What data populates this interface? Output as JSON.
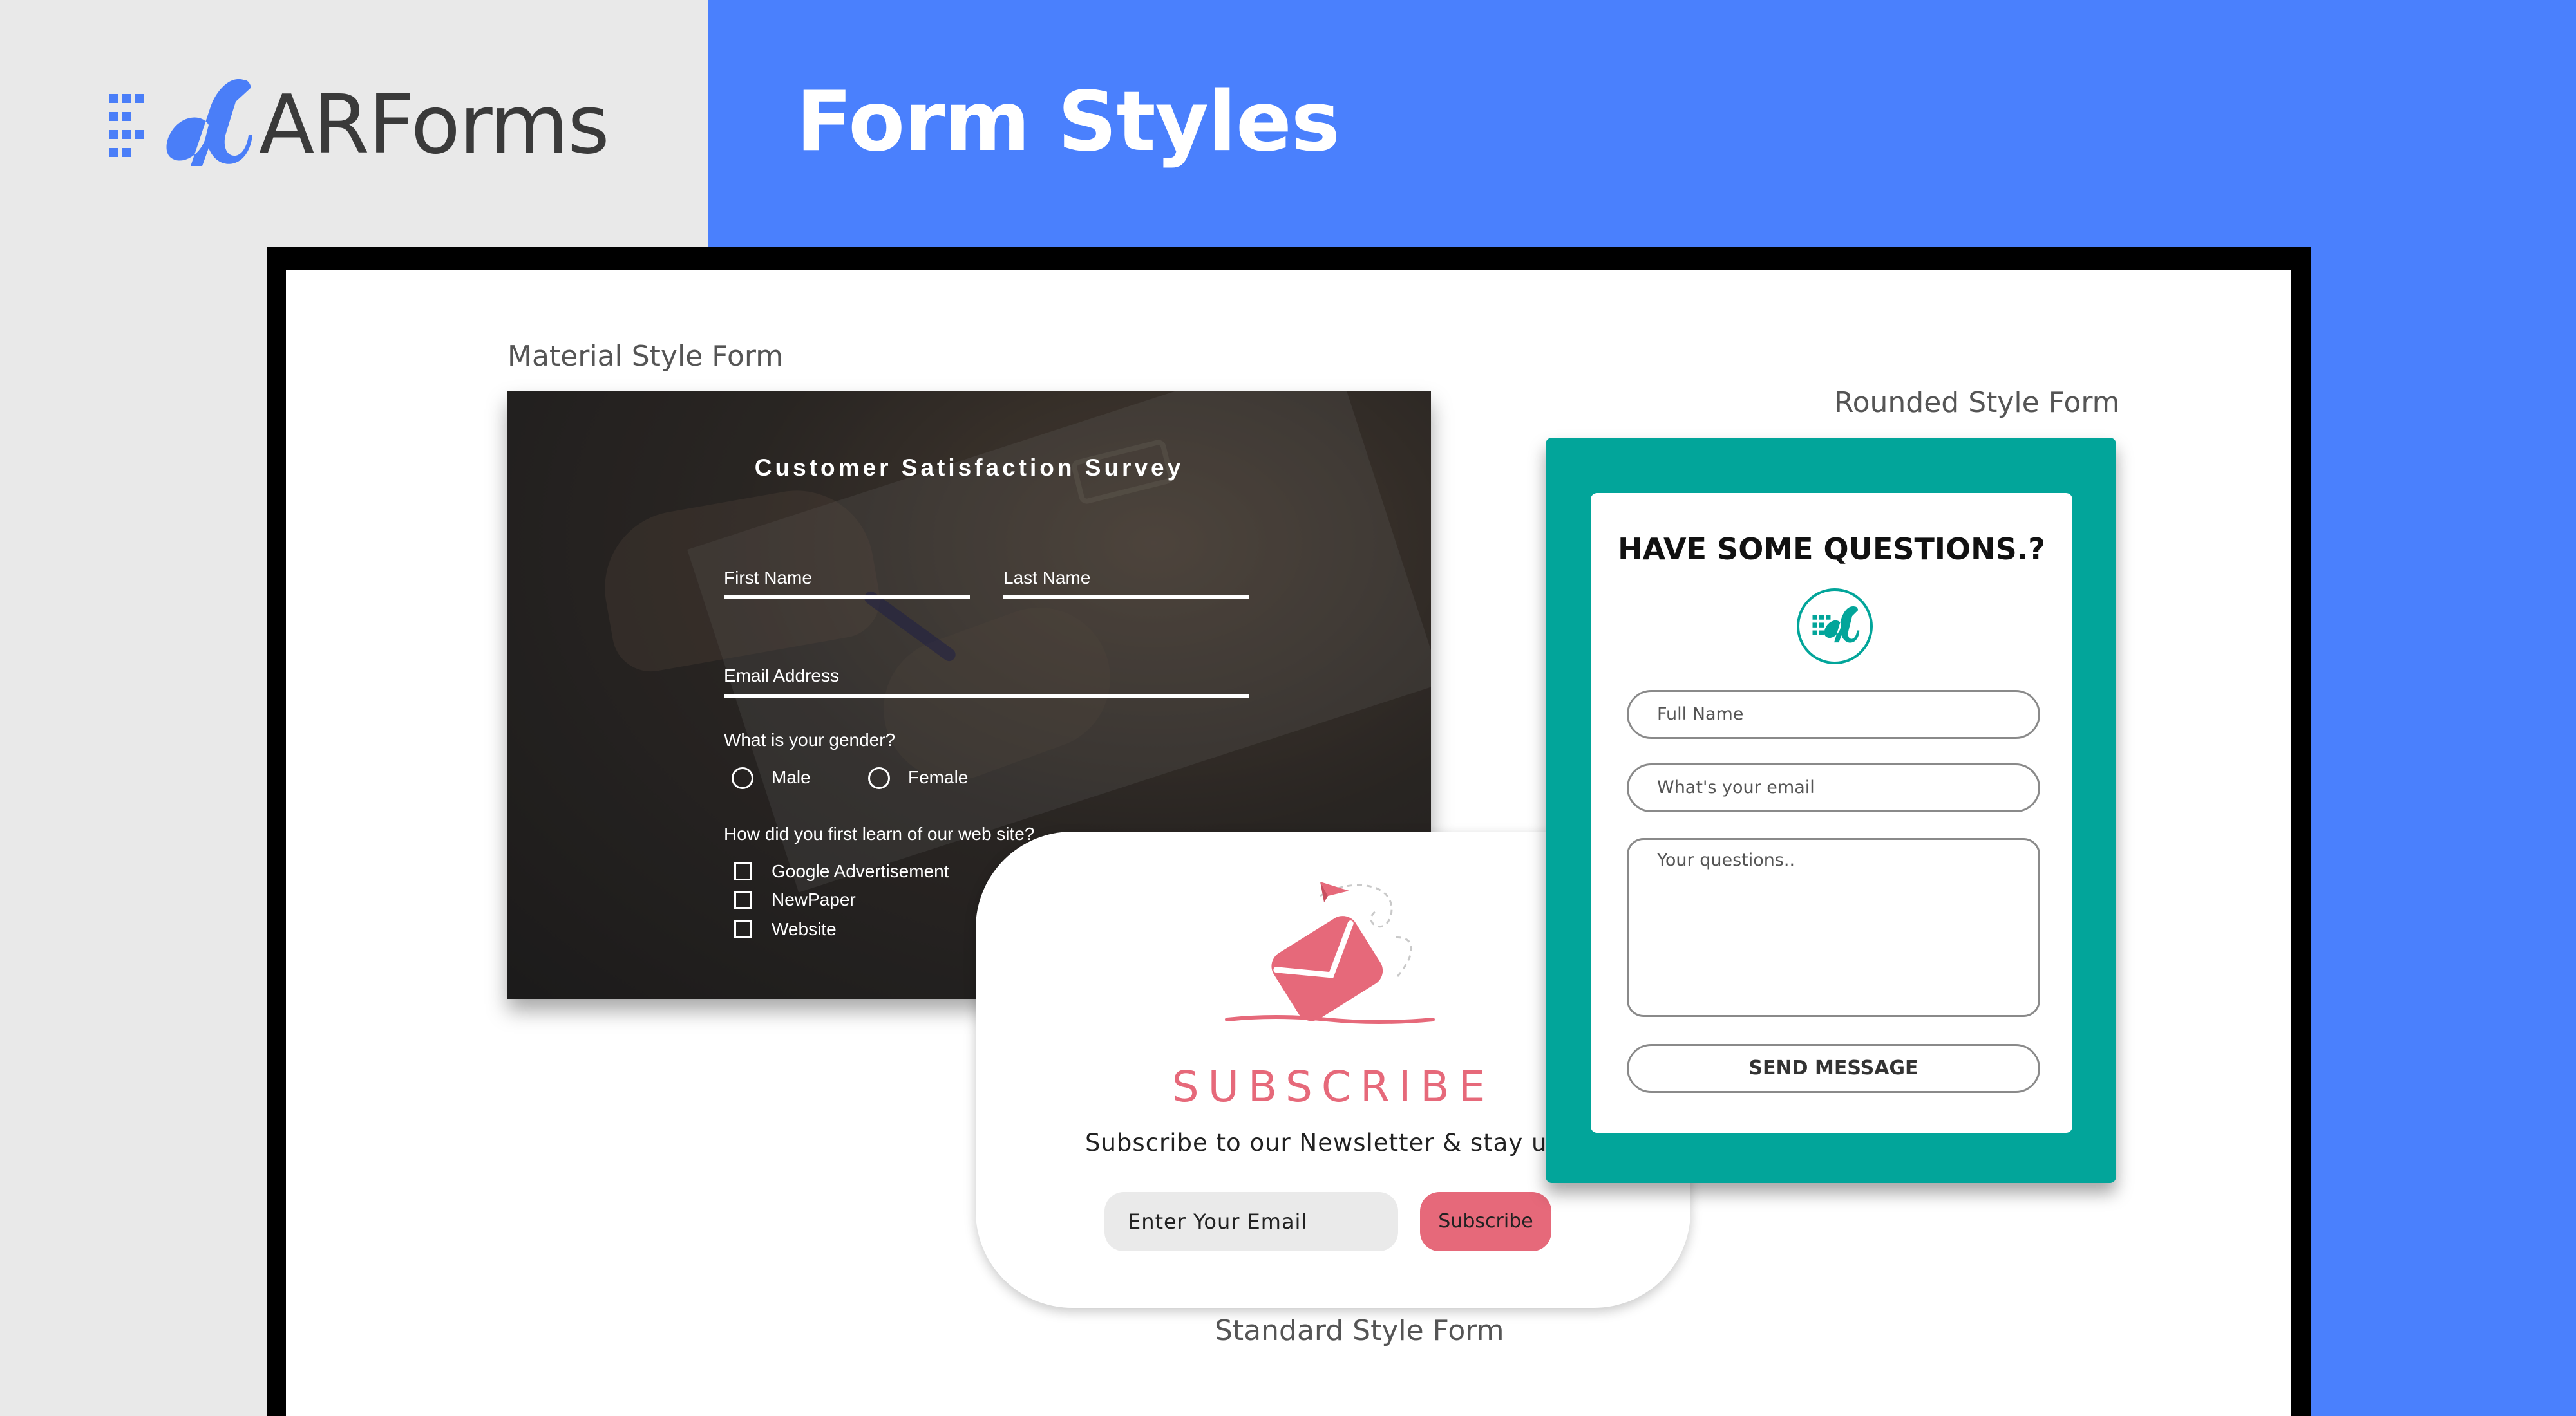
{
  "header": {
    "brand_name": "ARForms",
    "page_title": "Form Styles"
  },
  "labels": {
    "material": "Material Style Form",
    "rounded": "Rounded Style Form",
    "standard": "Standard  Style Form"
  },
  "material_form": {
    "title": "Customer Satisfaction Survey",
    "first_name": "First Name",
    "last_name": "Last Name",
    "email": "Email Address",
    "gender_question": "What is your gender?",
    "gender_options": [
      "Male",
      "Female"
    ],
    "source_question": "How did you first learn of our web site?",
    "source_options": [
      "Google Advertisement",
      "NewPaper",
      "Website"
    ]
  },
  "standard_form": {
    "title": "SUBSCRIBE",
    "description": "Subscribe to our Newsletter & stay upda",
    "email_placeholder": "Enter Your Email",
    "button": "Subscribe"
  },
  "rounded_form": {
    "title": "HAVE SOME QUESTIONS.?",
    "full_name_placeholder": "Full Name",
    "email_placeholder": "What's your email",
    "questions_placeholder": "Your questions..",
    "button": "SEND MESSAGE"
  },
  "colors": {
    "header_blue": "#4a80fd",
    "brand_blue": "#4a7ef8",
    "teal": "#02a59a",
    "subscribe_pink": "#e6697a"
  },
  "icons": [
    "arforms-logo-icon",
    "envelope-plane-icon"
  ]
}
